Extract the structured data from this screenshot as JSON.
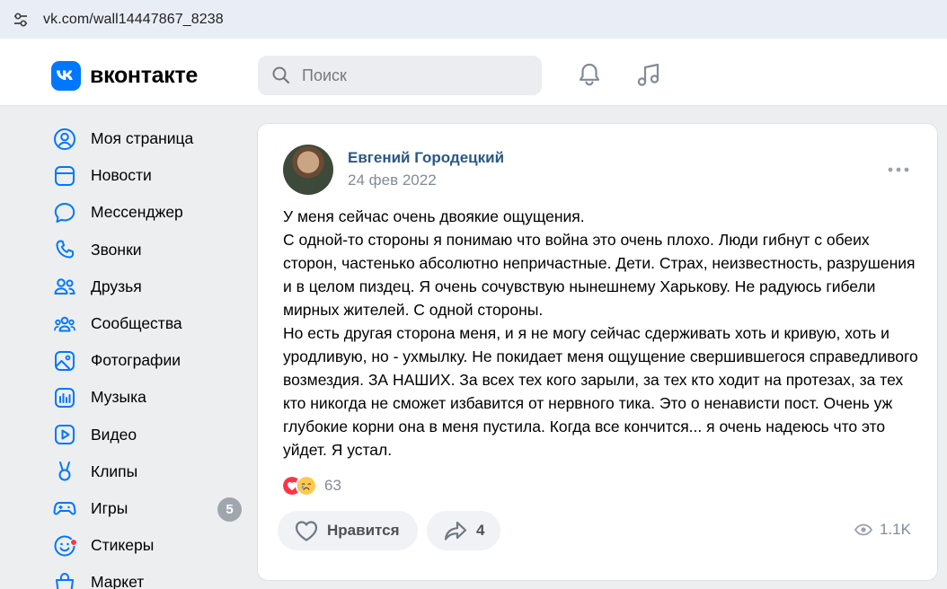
{
  "browser": {
    "url": "vk.com/wall14447867_8238"
  },
  "header": {
    "logo_text": "вконтакте",
    "search_placeholder": "Поиск",
    "accent": "#0077ff"
  },
  "sidebar": {
    "items": [
      {
        "label": "Моя страница",
        "icon": "user-circle-icon"
      },
      {
        "label": "Новости",
        "icon": "news-icon"
      },
      {
        "label": "Мессенджер",
        "icon": "message-icon"
      },
      {
        "label": "Звонки",
        "icon": "phone-icon"
      },
      {
        "label": "Друзья",
        "icon": "friends-icon"
      },
      {
        "label": "Сообщества",
        "icon": "communities-icon"
      },
      {
        "label": "Фотографии",
        "icon": "photo-icon"
      },
      {
        "label": "Музыка",
        "icon": "music-icon"
      },
      {
        "label": "Видео",
        "icon": "video-icon"
      },
      {
        "label": "Клипы",
        "icon": "clips-icon"
      },
      {
        "label": "Игры",
        "icon": "gamepad-icon",
        "badge": "5"
      },
      {
        "label": "Стикеры",
        "icon": "sticker-icon"
      },
      {
        "label": "Маркет",
        "icon": "market-icon"
      }
    ]
  },
  "post": {
    "author": "Евгений Городецкий",
    "date": "24 фев 2022",
    "text": [
      "У меня сейчас очень двоякие ощущения.",
      "С одной-то стороны я понимаю что война это очень плохо. Люди гибнут с обеих сторон, частенько абсолютно непричастные. Дети. Страх, неизвестность, разрушения и в целом пиздец. Я очень сочувствую нынешнему Харькову. Не радуюсь гибели мирных жителей. С одной стороны.",
      "Но есть другая сторона меня, и я не могу сейчас сдерживать хоть и кривую, хоть и уродливую, но - ухмылку. Не покидает меня ощущение свершившегося справедливого возмездия. ЗА НАШИХ. За всех тех кого зарыли, за тех кто ходит на протезах, за тех кто никогда не сможет избавится от нервного тика. Это о ненависти пост. Очень уж глубокие корни она в меня пустила. Когда все кончится... я очень надеюсь что это уйдет. Я устал."
    ],
    "reactions_count": "63",
    "like_label": "Нравится",
    "share_count": "4",
    "views": "1.1K"
  }
}
